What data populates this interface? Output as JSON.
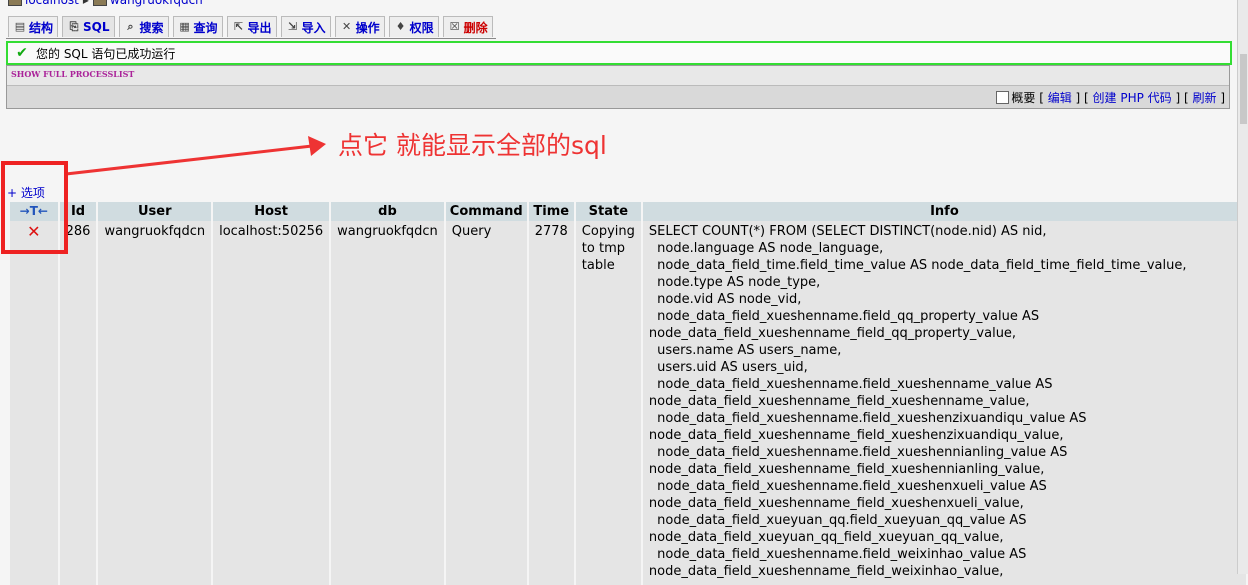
{
  "breadcrumb": {
    "server": "localhost",
    "database": "wangruokfqdcn"
  },
  "tabs": [
    {
      "label": "结构",
      "icon": "structure-icon",
      "glyph": "▤"
    },
    {
      "label": "SQL",
      "icon": "sql-icon",
      "glyph": "⎘"
    },
    {
      "label": "搜索",
      "icon": "search-icon",
      "glyph": "⌕"
    },
    {
      "label": "查询",
      "icon": "query-icon",
      "glyph": "▦"
    },
    {
      "label": "导出",
      "icon": "export-icon",
      "glyph": "⇱"
    },
    {
      "label": "导入",
      "icon": "import-icon",
      "glyph": "⇲"
    },
    {
      "label": "操作",
      "icon": "tools-icon",
      "glyph": "✕"
    },
    {
      "label": "权限",
      "icon": "privileges-icon",
      "glyph": "♦"
    },
    {
      "label": "删除",
      "icon": "delete-icon",
      "glyph": "☒"
    }
  ],
  "success_message": "您的 SQL 语句已成功运行",
  "sql_query": "SHOW FULL PROCESSLIST",
  "sql_tools": {
    "profile_label": "概要",
    "edit_label": "编辑",
    "create_php_label": "创建 PHP 代码",
    "refresh_label": "刷新"
  },
  "annotation_text": "点它 就能显示全部的sql",
  "options_link": "+ 选项",
  "table": {
    "headers": [
      "Id",
      "User",
      "Host",
      "db",
      "Command",
      "Time",
      "State",
      "Info"
    ],
    "row": {
      "id": "286",
      "user": "wangruokfqdcn",
      "host": "localhost:50256",
      "db": "wangruokfqdcn",
      "command": "Query",
      "time": "2778",
      "state": "Copying to tmp table",
      "info_lines": [
        "SELECT COUNT(*) FROM (SELECT DISTINCT(node.nid) AS nid,",
        "  node.language AS node_language,",
        "  node_data_field_time.field_time_value AS node_data_field_time_field_time_value,",
        "  node.type AS node_type,",
        "  node.vid AS node_vid,",
        "  node_data_field_xueshenname.field_qq_property_value AS",
        "node_data_field_xueshenname_field_qq_property_value,",
        "  users.name AS users_name,",
        "  users.uid AS users_uid,",
        "  node_data_field_xueshenname.field_xueshenname_value AS",
        "node_data_field_xueshenname_field_xueshenname_value,",
        "  node_data_field_xueshenname.field_xueshenzixuandiqu_value AS",
        "node_data_field_xueshenname_field_xueshenzixuandiqu_value,",
        "  node_data_field_xueshenname.field_xueshennianling_value AS",
        "node_data_field_xueshenname_field_xueshennianling_value,",
        "  node_data_field_xueshenname.field_xueshenxueli_value AS",
        "node_data_field_xueshenname_field_xueshenxueli_value,",
        "  node_data_field_xueyuan_qq.field_xueyuan_qq_value AS",
        "node_data_field_xueyuan_qq_field_xueyuan_qq_value,",
        "  node_data_field_xueshenname.field_weixinhao_value AS",
        "node_data_field_xueshenname_field_weixinhao_value,"
      ]
    }
  }
}
